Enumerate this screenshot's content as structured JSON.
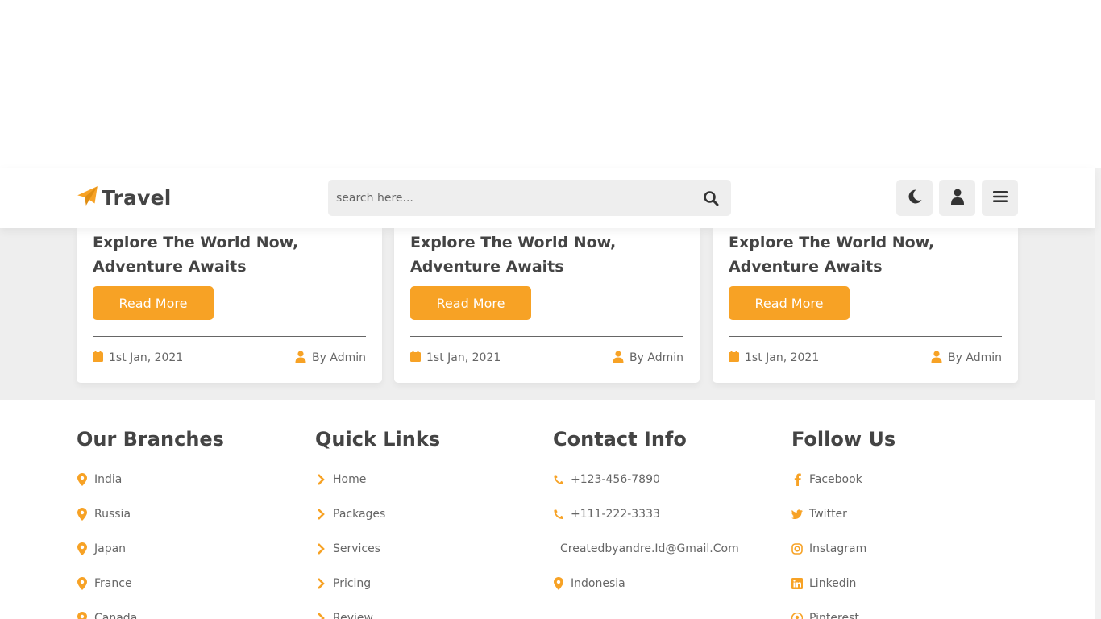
{
  "brand": {
    "name": "Travel",
    "accent": "#f7a225"
  },
  "search": {
    "placeholder": "search here..."
  },
  "nav_buttons": {
    "theme": "moon-icon",
    "user": "user-icon",
    "menu": "bars-icon"
  },
  "cards": [
    {
      "title": "Explore The World Now, Adventure Awaits",
      "button": "Read More",
      "date": "1st Jan, 2021",
      "author": "By Admin"
    },
    {
      "title": "Explore The World Now, Adventure Awaits",
      "button": "Read More",
      "date": "1st Jan, 2021",
      "author": "By Admin"
    },
    {
      "title": "Explore The World Now, Adventure Awaits",
      "button": "Read More",
      "date": "1st Jan, 2021",
      "author": "By Admin"
    }
  ],
  "footer": {
    "branches": {
      "heading": "Our Branches",
      "items": [
        "India",
        "Russia",
        "Japan",
        "France",
        "Canada"
      ]
    },
    "quick_links": {
      "heading": "Quick Links",
      "items": [
        "Home",
        "Packages",
        "Services",
        "Pricing",
        "Review"
      ]
    },
    "contact": {
      "heading": "Contact Info",
      "phone1": "+123-456-7890",
      "phone2": "+111-222-3333",
      "email": "Createdbyandre.Id@Gmail.Com",
      "location": "Indonesia"
    },
    "follow": {
      "heading": "Follow Us",
      "items": [
        "Facebook",
        "Twitter",
        "Instagram",
        "Linkedin",
        "Pinterest"
      ]
    }
  }
}
